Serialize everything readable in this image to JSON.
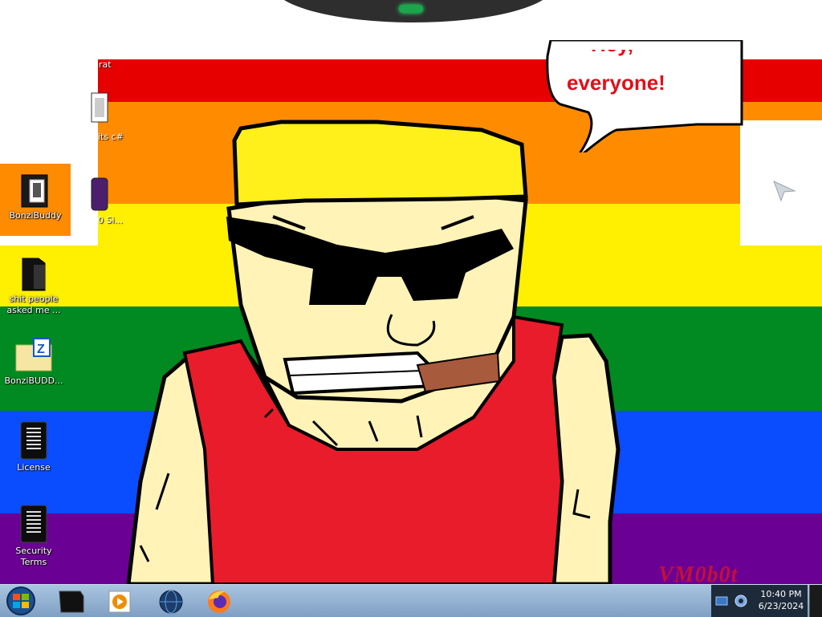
{
  "speech_bubble": {
    "partial_line": "Hey, everyone!",
    "text": "everyone!"
  },
  "desktop_icons": [
    {
      "label": "rat"
    },
    {
      "label": "its c#"
    },
    {
      "label": "BonziBuddy"
    },
    {
      "label": "0 Si..."
    },
    {
      "label": "shit people asked me ..."
    },
    {
      "label": "BonziBUDD..."
    },
    {
      "label": "License"
    },
    {
      "label": "Security Terms"
    }
  ],
  "watermark": "VM0b0t",
  "taskbar": {
    "start_button": "start-orb",
    "pinned": [
      "command-prompt-icon",
      "media-player-icon",
      "browser-globe-icon",
      "firefox-icon"
    ],
    "tray_icons": [
      "network-icon",
      "volume-icon"
    ],
    "clock": {
      "time": "10:40 PM",
      "date": "6/23/2024"
    }
  },
  "colors": {
    "red": "#e60000",
    "orange": "#ff8c00",
    "yellow": "#ffef00",
    "green": "#008a21",
    "blue": "#0a4cff",
    "purple": "#6b0094",
    "bubble_text": "#e0101a"
  }
}
